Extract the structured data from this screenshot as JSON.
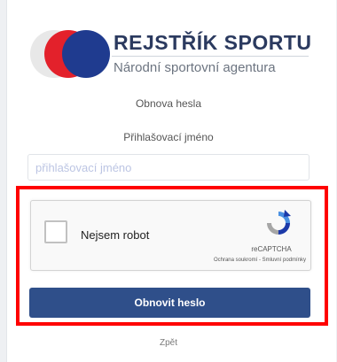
{
  "logo": {
    "brand": "REJSTŘÍK SPORTU",
    "agency": "Národní sportovní agentura"
  },
  "form": {
    "title": "Obnova hesla",
    "login_label": "Přihlašovací jméno",
    "login_placeholder": "přihlašovací jméno",
    "login_value": ""
  },
  "captcha": {
    "label": "Nejsem robot",
    "brand": "reCAPTCHA",
    "privacy": "Ochrana soukromí",
    "separator": " - ",
    "terms": "Smluvní podmínky",
    "checked": false
  },
  "actions": {
    "submit_label": "Obnovit heslo",
    "back_label": "Zpět"
  },
  "colors": {
    "primary_button": "#2f4f8a",
    "highlight": "#ff0000",
    "logo_red": "#e3212b",
    "logo_blue": "#1f3b8f"
  }
}
